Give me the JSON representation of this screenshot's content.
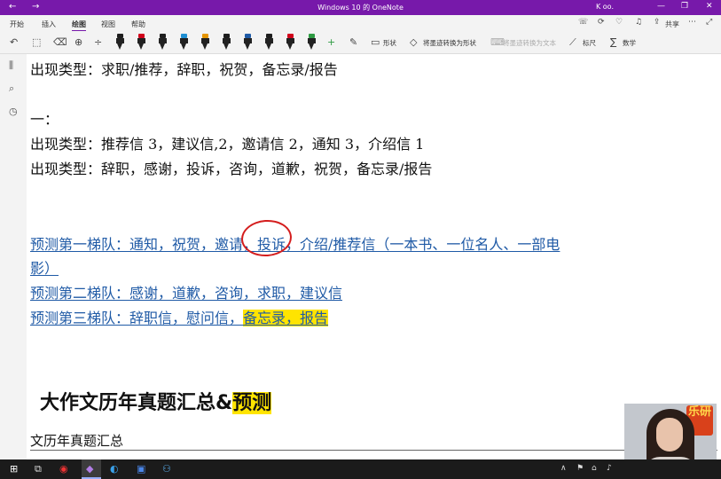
{
  "window": {
    "title": "Windows 10 的 OneNote",
    "user": "K oo."
  },
  "tabs": [
    "开始",
    "插入",
    "绘图",
    "视图",
    "帮助"
  ],
  "active_tab": "绘图",
  "share_label": "共享",
  "toolbar": {
    "pen_colors": [
      "#1e1e1e",
      "#d0021b",
      "#1e1e1e",
      "#1f8fd3",
      "#e59500",
      "#1e1e1e",
      "#1f5aa6",
      "#1e1e1e",
      "#d0021b",
      "#2e9b43"
    ],
    "shapes_label": "形状",
    "ink_to_shape": "将墨迹转换为形状",
    "ink_to_text": "将墨迹转换为文本",
    "ruler": "标尺",
    "math": "数学"
  },
  "note": {
    "line1": "出现类型：求职/推荐，辞职，祝贺，备忘录/报告",
    "line2": "一：",
    "line3": "出现类型：推荐信 3，建议信,2，邀请信 2，通知 3，介绍信 1",
    "line4": "出现类型：辞职，感谢，投诉，咨询，道歉，祝贺，备忘录/报告",
    "pred1_a": "预测第一梯队：通知，祝贺，",
    "pred1_b": "邀请",
    "pred1_c": "，投诉，介绍/推荐信（一本书、一位名人、一部电",
    "pred1_d": "影）",
    "pred2": "预测第二梯队：感谢，道歉，咨询，求职，建议信",
    "pred3_a": "预测第三梯队：辞职信，慰问信，",
    "pred3_b": "备忘录，报告",
    "heading_a": "大作文历年真题汇总&",
    "heading_b": "预测",
    "subheading": "文历年真题汇总"
  },
  "webcam": {
    "sign_text": "乐研"
  }
}
